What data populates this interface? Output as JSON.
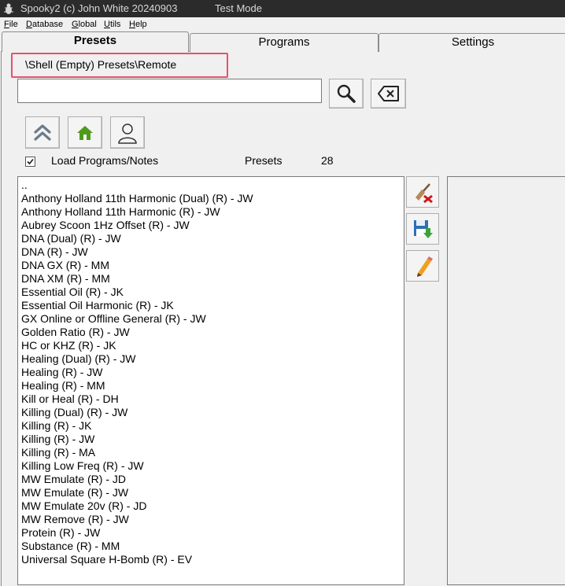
{
  "window": {
    "title": "Spooky2 (c) John White 20240903",
    "mode": "Test Mode"
  },
  "menu": [
    "File",
    "Database",
    "Global",
    "Utils",
    "Help"
  ],
  "tabs": [
    "Presets",
    "Programs",
    "Settings"
  ],
  "breadcrumb": "\\Shell (Empty) Presets\\Remote",
  "search": {
    "value": "",
    "placeholder": ""
  },
  "icons": {
    "search": "search-icon",
    "clear": "backspace-icon",
    "up": "chevron-up-icon",
    "home": "home-icon",
    "user": "user-icon",
    "delete": "brush-delete-icon",
    "save": "save-icon",
    "edit": "pencil-icon"
  },
  "options": {
    "load_programs_notes_label": "Load Programs/Notes",
    "load_programs_notes_checked": true,
    "presets_label": "Presets",
    "presets_count": "28"
  },
  "presets": [
    "..",
    "Anthony Holland 11th Harmonic (Dual) (R) - JW",
    "Anthony Holland 11th Harmonic (R) - JW",
    "Aubrey Scoon 1Hz Offset (R) - JW",
    "DNA (Dual) (R) - JW",
    "DNA (R) - JW",
    "DNA GX (R) - MM",
    "DNA XM (R) - MM",
    "Essential Oil (R) - JK",
    "Essential Oil Harmonic (R) - JK",
    "GX Online or Offline General (R) - JW",
    "Golden Ratio (R) - JW",
    "HC or KHZ (R) - JK",
    "Healing (Dual) (R) - JW",
    "Healing (R) - JW",
    "Healing (R) - MM",
    "Kill or Heal (R) - DH",
    "Killing (Dual) (R) - JW",
    "Killing (R) - JK",
    "Killing (R) - JW",
    "Killing (R) - MA",
    "Killing Low Freq (R) - JW",
    "MW Emulate (R) - JD",
    "MW Emulate (R) - JW",
    "MW Emulate 20v (R) - JD",
    "MW Remove (R) - JW",
    "Protein (R) - JW",
    "Substance (R) - MM",
    "Universal Square H-Bomb (R) - EV"
  ],
  "colors": {
    "titlebar": "#2b2b2b",
    "highlight_border": "#e8506a",
    "home_green": "#4f9a1c"
  }
}
